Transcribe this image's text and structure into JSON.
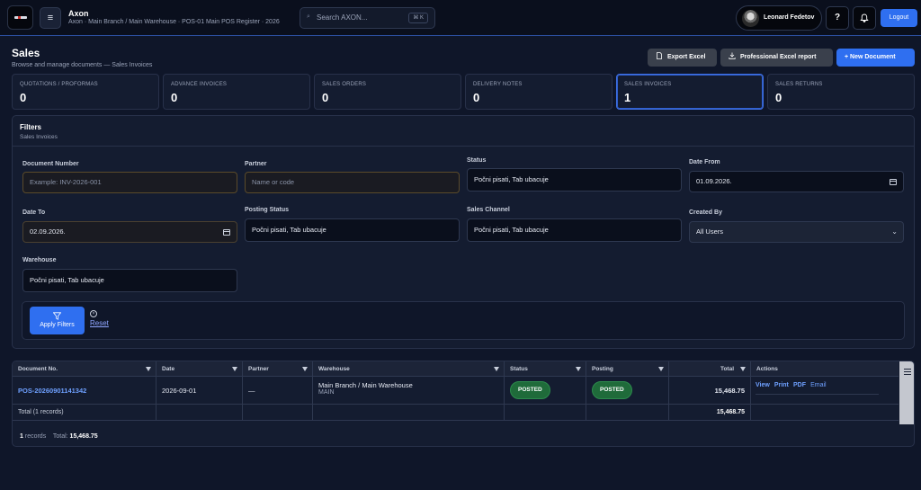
{
  "topbar": {
    "app_title": "Axon",
    "context": "Axon · Main Branch / Main Warehouse · POS-01 Main POS Register · 2026",
    "search_placeholder": "Search AXON...",
    "search_shortcut": "⌘ K",
    "user_name": "Leonard Fedetov",
    "help_label": "?",
    "logout_label": "Logout"
  },
  "page": {
    "title": "Sales",
    "subtitle": "Browse and manage documents — Sales Invoices"
  },
  "actions": {
    "export_excel": "Export Excel",
    "pro_excel": "Professional Excel report",
    "new_document": "+ New Document"
  },
  "kpis": [
    {
      "label": "QUOTATIONS / PROFORMAS",
      "value": "0"
    },
    {
      "label": "ADVANCE INVOICES",
      "value": "0"
    },
    {
      "label": "SALES ORDERS",
      "value": "0"
    },
    {
      "label": "DELIVERY NOTES",
      "value": "0"
    },
    {
      "label": "SALES INVOICES",
      "value": "1"
    },
    {
      "label": "SALES RETURNS",
      "value": "0"
    }
  ],
  "filters": {
    "title": "Filters",
    "subtitle": "Sales Invoices",
    "document_number": {
      "label": "Document Number",
      "placeholder": "Example: INV-2026-001"
    },
    "partner": {
      "label": "Partner",
      "placeholder": "Name or code"
    },
    "status": {
      "label": "Status",
      "value": "Počni pisati, Tab ubacuje"
    },
    "date_from": {
      "label": "Date From",
      "value": "01.09.2026."
    },
    "date_to": {
      "label": "Date To",
      "value": "02.09.2026."
    },
    "posting_status": {
      "label": "Posting Status",
      "value": "Počni pisati, Tab ubacuje"
    },
    "sales_channel": {
      "label": "Sales Channel",
      "value": "Počni pisati, Tab ubacuje"
    },
    "created_by": {
      "label": "Created By",
      "value": "All Users"
    },
    "warehouse": {
      "label": "Warehouse",
      "value": "Počni pisati, Tab ubacuje"
    },
    "apply_label": "Apply Filters",
    "reset_label": "Reset"
  },
  "grid": {
    "columns": [
      "Document No.",
      "Date",
      "Partner",
      "Warehouse",
      "Status",
      "Posting",
      "Total",
      "Actions"
    ],
    "row": {
      "doc_no": "POS-20260901141342",
      "date": "2026-09-01",
      "partner": "—",
      "warehouse_line1": "Main Branch / Main Warehouse",
      "warehouse_line2": "MAIN",
      "status": "POSTED",
      "posting": "POSTED",
      "total": "15,468.75",
      "actions": [
        "View",
        "Print",
        "PDF",
        "Email"
      ]
    },
    "total_row": {
      "label": "Total (1 records)",
      "total": "15,468.75"
    },
    "footer": {
      "records_count": "1",
      "records_label": "records",
      "total_label": "Total:",
      "total_value": "15,468.75"
    }
  },
  "colors": {
    "accent": "#2f6ff0",
    "badge_green": "#1f6b3a",
    "link": "#6ea0ff",
    "background": "#0f1629"
  }
}
